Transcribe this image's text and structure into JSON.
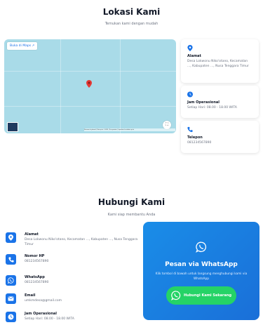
{
  "location": {
    "title": "Lokasi Kami",
    "subtitle": "Temukan kami dengan mudah",
    "map_link": "Buka di Maps",
    "map_attribution": "Pintasan keyboard | Data peta ©2025 | Persyaratan | Laporkan kesalahan peta",
    "cards": [
      {
        "title": "Alamat",
        "value": "Desa Lokwonu Niko'otano, Kecamatan ..., Kabupaten ..., Nusa Tenggara Timur"
      },
      {
        "title": "Jam Operasional",
        "value": "Setiap Hari: 08.00 - 18.00 WITA"
      },
      {
        "title": "Telepon",
        "value": "081234567890"
      }
    ]
  },
  "contact": {
    "title": "Hubungi Kami",
    "subtitle": "Kami siap membantu Anda",
    "items": [
      {
        "title": "Alamat",
        "value": "Desa Lokwonu Niko'otano, Kecamatan ..., Kabupaten ..., Nusa Tenggara Timur"
      },
      {
        "title": "Nomor HP",
        "value": "081234567890"
      },
      {
        "title": "WhatsApp",
        "value": "081234567890"
      },
      {
        "title": "Email",
        "value": "umkmdesa@gmail.com"
      },
      {
        "title": "Jam Operasional",
        "value": "Setiap Hari: 08.00 - 18.00 WITA"
      }
    ]
  },
  "whatsapp": {
    "title": "Pesan via WhatsApp",
    "description": "Klik tombol di bawah untuk langsung menghubungi kami via WhatsApp",
    "button": "Hubungi Kami Sekarang"
  },
  "colors": {
    "accent": "#1a73e8",
    "whatsapp_green": "#25d366",
    "map_water": "#a9dbe8",
    "pin": "#e53935"
  }
}
